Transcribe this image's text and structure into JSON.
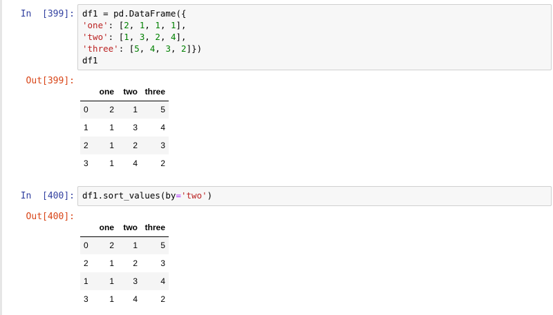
{
  "cells": [
    {
      "in_prompt": "In  [399]:",
      "code_lines": [
        [
          {
            "t": "df1 = pd.DataFrame({",
            "k": "plain"
          }
        ],
        [
          {
            "t": "'one'",
            "k": "str"
          },
          {
            "t": ": [",
            "k": "plain"
          },
          {
            "t": "2",
            "k": "num"
          },
          {
            "t": ", ",
            "k": "plain"
          },
          {
            "t": "1",
            "k": "num"
          },
          {
            "t": ", ",
            "k": "plain"
          },
          {
            "t": "1",
            "k": "num"
          },
          {
            "t": ", ",
            "k": "plain"
          },
          {
            "t": "1",
            "k": "num"
          },
          {
            "t": "],",
            "k": "plain"
          }
        ],
        [
          {
            "t": "'two'",
            "k": "str"
          },
          {
            "t": ": [",
            "k": "plain"
          },
          {
            "t": "1",
            "k": "num"
          },
          {
            "t": ", ",
            "k": "plain"
          },
          {
            "t": "3",
            "k": "num"
          },
          {
            "t": ", ",
            "k": "plain"
          },
          {
            "t": "2",
            "k": "num"
          },
          {
            "t": ", ",
            "k": "plain"
          },
          {
            "t": "4",
            "k": "num"
          },
          {
            "t": "],",
            "k": "plain"
          }
        ],
        [
          {
            "t": "'three'",
            "k": "str"
          },
          {
            "t": ": [",
            "k": "plain"
          },
          {
            "t": "5",
            "k": "num"
          },
          {
            "t": ", ",
            "k": "plain"
          },
          {
            "t": "4",
            "k": "num"
          },
          {
            "t": ", ",
            "k": "plain"
          },
          {
            "t": "3",
            "k": "num"
          },
          {
            "t": ", ",
            "k": "plain"
          },
          {
            "t": "2",
            "k": "num"
          },
          {
            "t": "]})",
            "k": "plain"
          }
        ],
        [
          {
            "t": "df1",
            "k": "plain"
          }
        ]
      ],
      "out_prompt": "Out[399]:",
      "table": {
        "columns": [
          "one",
          "two",
          "three"
        ],
        "rows": [
          {
            "index": "0",
            "values": [
              "2",
              "1",
              "5"
            ]
          },
          {
            "index": "1",
            "values": [
              "1",
              "3",
              "4"
            ]
          },
          {
            "index": "2",
            "values": [
              "1",
              "2",
              "3"
            ]
          },
          {
            "index": "3",
            "values": [
              "1",
              "4",
              "2"
            ]
          }
        ]
      }
    },
    {
      "in_prompt": "In  [400]:",
      "code_lines": [
        [
          {
            "t": "df1.sort_values(by",
            "k": "plain"
          },
          {
            "t": "=",
            "k": "op"
          },
          {
            "t": "'two'",
            "k": "str"
          },
          {
            "t": ")",
            "k": "plain"
          }
        ]
      ],
      "out_prompt": "Out[400]:",
      "table": {
        "columns": [
          "one",
          "two",
          "three"
        ],
        "rows": [
          {
            "index": "0",
            "values": [
              "2",
              "1",
              "5"
            ]
          },
          {
            "index": "2",
            "values": [
              "1",
              "2",
              "3"
            ]
          },
          {
            "index": "1",
            "values": [
              "1",
              "3",
              "4"
            ]
          },
          {
            "index": "3",
            "values": [
              "1",
              "4",
              "2"
            ]
          }
        ]
      }
    }
  ],
  "colors": {
    "in_prompt": "#303f9f",
    "out_prompt": "#d84315",
    "string": "#ba2121",
    "number": "#008000",
    "operator": "#aa22ff",
    "input_bg": "#f7f7f7",
    "input_border": "#cfcfcf"
  }
}
